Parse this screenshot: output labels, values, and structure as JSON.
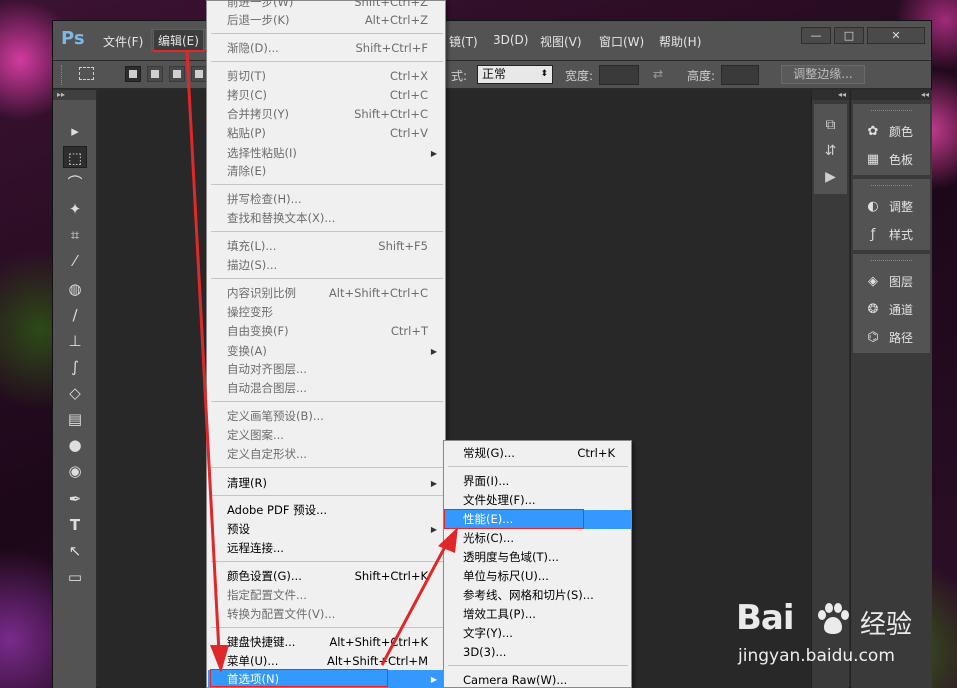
{
  "app": {
    "logo": "Ps",
    "menus": [
      "文件(F)",
      "编辑(E)",
      "镜(T)",
      "3D(D)",
      "视图(V)",
      "窗口(W)",
      "帮助(H)"
    ],
    "active_menu": "编辑(E)",
    "window_buttons": [
      "—",
      "□",
      "✕"
    ]
  },
  "options_bar": {
    "style_label": "式:",
    "style_value": "正常",
    "width_label": "宽度:",
    "height_label": "高度:",
    "refine_button": "调整边缘..."
  },
  "tools": [
    "move-icon",
    "rect-marquee-icon",
    "lasso-icon",
    "magic-wand-icon",
    "crop-icon",
    "eyedropper-icon",
    "healing-icon",
    "brush-icon",
    "stamp-icon",
    "history-brush-icon",
    "eraser-icon",
    "gradient-icon",
    "blur-icon",
    "dodge-icon",
    "pen-icon",
    "type-icon",
    "path-select-icon",
    "shape-icon"
  ],
  "tool_glyphs": {
    "move": "▸",
    "rect": "⬚",
    "lasso": "⌒",
    "wand": "✦",
    "crop": "⌗",
    "eyedropper": "⁄",
    "healing": "◍",
    "brush": "∕",
    "stamp": "⊥",
    "historybrush": "∫",
    "eraser": "◇",
    "gradient": "▤",
    "blur": "●",
    "dodge": "◉",
    "pen": "✒",
    "type": "T",
    "pathsel": "↖",
    "shape": "▭"
  },
  "panels": {
    "group1": [
      {
        "icon": "color-icon",
        "label": "颜色"
      },
      {
        "icon": "swatches-icon",
        "label": "色板"
      }
    ],
    "group2": [
      {
        "icon": "adjustments-icon",
        "label": "调整"
      },
      {
        "icon": "styles-icon",
        "label": "样式"
      }
    ],
    "group3": [
      {
        "icon": "layers-icon",
        "label": "图层"
      },
      {
        "icon": "channels-icon",
        "label": "通道"
      },
      {
        "icon": "paths-icon",
        "label": "路径"
      }
    ]
  },
  "edit_menu": {
    "step_forward": {
      "label": "前进一步(W)",
      "shortcut": "Shift+Ctrl+Z"
    },
    "step_backward": {
      "label": "后退一步(K)",
      "shortcut": "Alt+Ctrl+Z"
    },
    "fade": {
      "label": "渐隐(D)...",
      "shortcut": "Shift+Ctrl+F"
    },
    "cut": {
      "label": "剪切(T)",
      "shortcut": "Ctrl+X"
    },
    "copy": {
      "label": "拷贝(C)",
      "shortcut": "Ctrl+C"
    },
    "copy_merged": {
      "label": "合并拷贝(Y)",
      "shortcut": "Shift+Ctrl+C"
    },
    "paste": {
      "label": "粘贴(P)",
      "shortcut": "Ctrl+V"
    },
    "paste_special": {
      "label": "选择性粘贴(I)"
    },
    "clear": {
      "label": "清除(E)"
    },
    "spell_check": {
      "label": "拼写检查(H)..."
    },
    "find_replace": {
      "label": "查找和替换文本(X)..."
    },
    "fill": {
      "label": "填充(L)...",
      "shortcut": "Shift+F5"
    },
    "stroke": {
      "label": "描边(S)..."
    },
    "content_aware_scale": {
      "label": "内容识别比例",
      "shortcut": "Alt+Shift+Ctrl+C"
    },
    "puppet_warp": {
      "label": "操控变形"
    },
    "free_transform": {
      "label": "自由变换(F)",
      "shortcut": "Ctrl+T"
    },
    "transform": {
      "label": "变换(A)"
    },
    "auto_align": {
      "label": "自动对齐图层..."
    },
    "auto_blend": {
      "label": "自动混合图层..."
    },
    "define_brush": {
      "label": "定义画笔预设(B)..."
    },
    "define_pattern": {
      "label": "定义图案..."
    },
    "define_shape": {
      "label": "定义自定形状..."
    },
    "purge": {
      "label": "清理(R)"
    },
    "pdf_presets": {
      "label": "Adobe PDF 预设..."
    },
    "presets": {
      "label": "预设"
    },
    "remote": {
      "label": "远程连接..."
    },
    "color_settings": {
      "label": "颜色设置(G)...",
      "shortcut": "Shift+Ctrl+K"
    },
    "assign_profile": {
      "label": "指定配置文件..."
    },
    "convert_profile": {
      "label": "转换为配置文件(V)..."
    },
    "keyboard_shortcuts": {
      "label": "键盘快捷键...",
      "shortcut": "Alt+Shift+Ctrl+K"
    },
    "menus": {
      "label": "菜单(U)...",
      "shortcut": "Alt+Shift+Ctrl+M"
    },
    "preferences": {
      "label": "首选项(N)"
    },
    "submenu_arrow": "▶"
  },
  "preferences_menu": {
    "general": {
      "label": "常规(G)...",
      "shortcut": "Ctrl+K"
    },
    "interface": {
      "label": "界面(I)..."
    },
    "file_handling": {
      "label": "文件处理(F)..."
    },
    "performance": {
      "label": "性能(E)..."
    },
    "cursors": {
      "label": "光标(C)..."
    },
    "transparency": {
      "label": "透明度与色域(T)..."
    },
    "units": {
      "label": "单位与标尺(U)..."
    },
    "guides": {
      "label": "参考线、网格和切片(S)..."
    },
    "plugins": {
      "label": "增效工具(P)..."
    },
    "type": {
      "label": "文字(Y)..."
    },
    "three_d": {
      "label": "3D(3)..."
    },
    "camera_raw": {
      "label": "Camera Raw(W)..."
    }
  },
  "watermark": {
    "brand": "Bai",
    "brand2": "du",
    "cn": "经验",
    "url": "jingyan.baidu.com"
  },
  "colors": {
    "highlight": "#3399ff",
    "annotation": "#e0282a",
    "menu_bg": "#f0f0f0"
  }
}
